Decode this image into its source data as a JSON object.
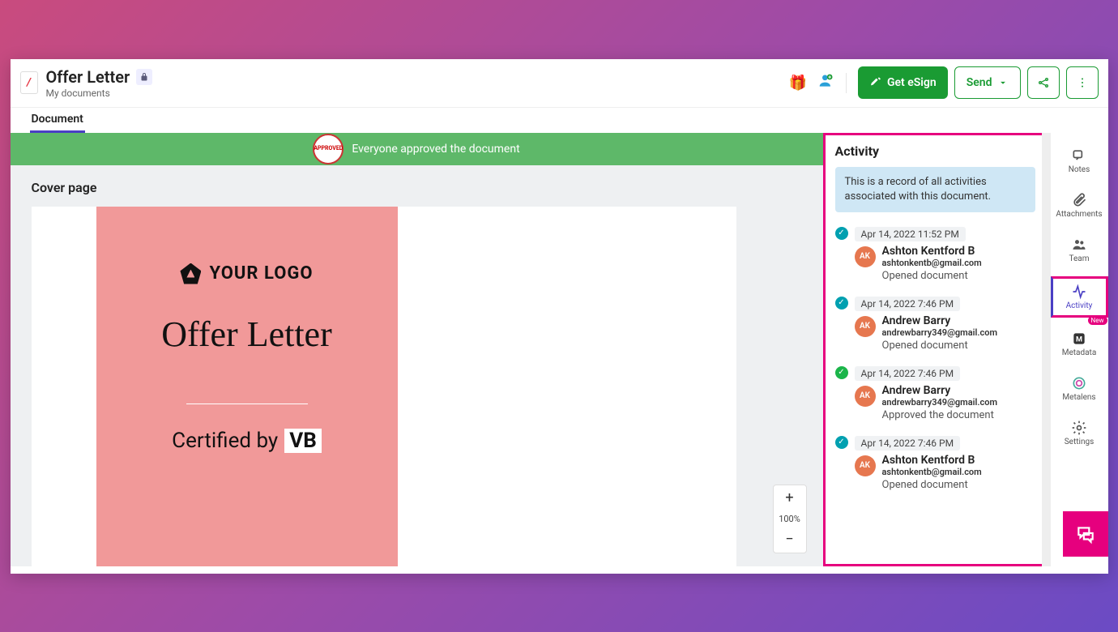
{
  "header": {
    "doc_icon_char": "/",
    "title": "Offer Letter",
    "breadcrumb": "My documents",
    "esign_label": "Get eSign",
    "send_label": "Send"
  },
  "tabs": {
    "document": "Document"
  },
  "banner": {
    "text": "Everyone approved the document",
    "stamp_text": "APPROVED"
  },
  "viewer": {
    "section_title": "Cover page",
    "logo_text": "YOUR LOGO",
    "main_title": "Offer Letter",
    "certified_label": "Certified by",
    "cert_badge": "VB",
    "zoom_value": "100%"
  },
  "activity": {
    "title": "Activity",
    "description": "This is a record of all activities associated with this document.",
    "items": [
      {
        "status": "teal",
        "date": "Apr 14, 2022 11:52 PM",
        "avatar": "AK",
        "name": "Ashton Kentford B",
        "email": "ashtonkentb@gmail.com",
        "action": "Opened document"
      },
      {
        "status": "teal",
        "date": "Apr 14, 2022 7:46 PM",
        "avatar": "AK",
        "name": "Andrew Barry",
        "email": "andrewbarry349@gmail.com",
        "action": "Opened document"
      },
      {
        "status": "green",
        "date": "Apr 14, 2022 7:46 PM",
        "avatar": "AK",
        "name": "Andrew Barry",
        "email": "andrewbarry349@gmail.com",
        "action": "Approved the document"
      },
      {
        "status": "teal",
        "date": "Apr 14, 2022 7:46 PM",
        "avatar": "AK",
        "name": "Ashton Kentford B",
        "email": "ashtonkentb@gmail.com",
        "action": "Opened document"
      }
    ]
  },
  "rail": {
    "notes": "Notes",
    "attachments": "Attachments",
    "team": "Team",
    "activity": "Activity",
    "metadata": "Metadata",
    "metalens": "Metalens",
    "settings": "Settings",
    "new_badge": "New"
  }
}
